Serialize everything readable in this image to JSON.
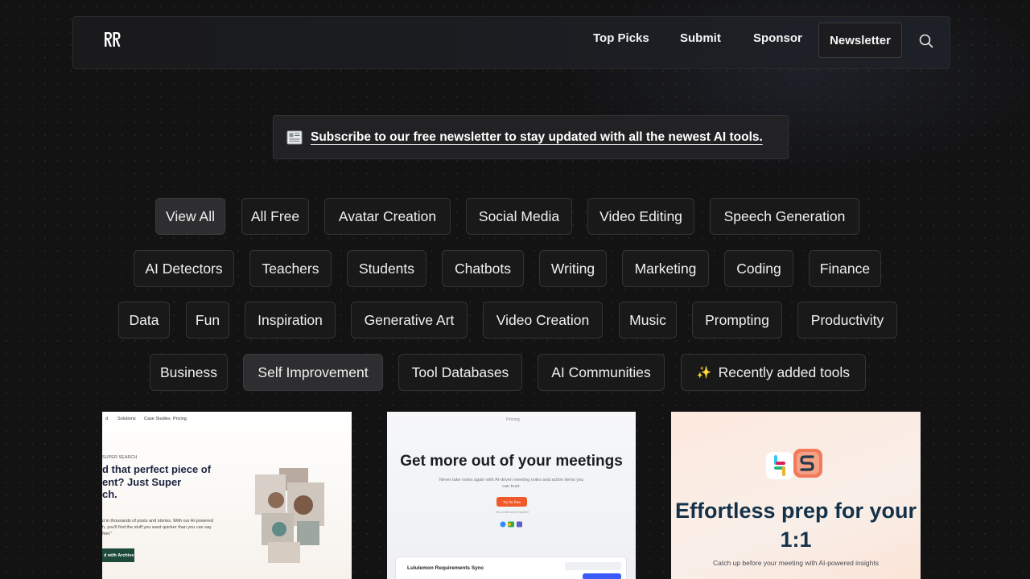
{
  "nav": {
    "links": [
      "Top Picks",
      "Submit",
      "Sponsor"
    ],
    "newsletter": "Newsletter"
  },
  "banner": {
    "icon": "newspaper-icon",
    "text": "Subscribe to our free newsletter to stay updated with all the newest AI tools."
  },
  "categories": {
    "row1": [
      "View All",
      "All Free",
      "Avatar Creation",
      "Social Media",
      "Video Editing",
      "Speech Generation"
    ],
    "row2": [
      "AI Detectors",
      "Teachers",
      "Students",
      "Chatbots",
      "Writing",
      "Marketing",
      "Coding",
      "Finance"
    ],
    "row3": [
      "Data",
      "Fun",
      "Inspiration",
      "Generative Art",
      "Video Creation",
      "Music",
      "Prompting",
      "Productivity"
    ],
    "row4": [
      "Business",
      "Self Improvement",
      "Tool Databases",
      "AI Communities",
      "Recently added tools"
    ],
    "active": [
      "View All",
      "Self Improvement"
    ]
  },
  "cards": [
    {
      "nav": [
        "Solutions",
        "Case Studies",
        "Pricing"
      ],
      "eyebrow": "SUPER SEARCH",
      "headline": "d that perfect piece of\nent? Just Super\nch.",
      "body": "d in thousands of posts and stories. With our AI-powered\nh, you'll find the stuff you want quicker than you can say\nfeel.\"",
      "button": "d with Archive"
    },
    {
      "nav": "Pricing",
      "title": "Get more out of your meetings",
      "subtitle": "Never take notes again with AI-driven meeting notes and action items you can trust.",
      "button": "Try for free",
      "note": "No credit card required",
      "panel_title": "Lululemon Requirements Sync"
    },
    {
      "title": "Effortless prep for your 1:1",
      "subtitle": "Catch up before your meeting with AI-powered insights"
    }
  ],
  "colors": {
    "background": "#131314",
    "chip_bg": "#19191a",
    "chip_active_bg": "#2e2e30",
    "card3_title": "#13324a",
    "card2_button": "#f05a2a"
  }
}
